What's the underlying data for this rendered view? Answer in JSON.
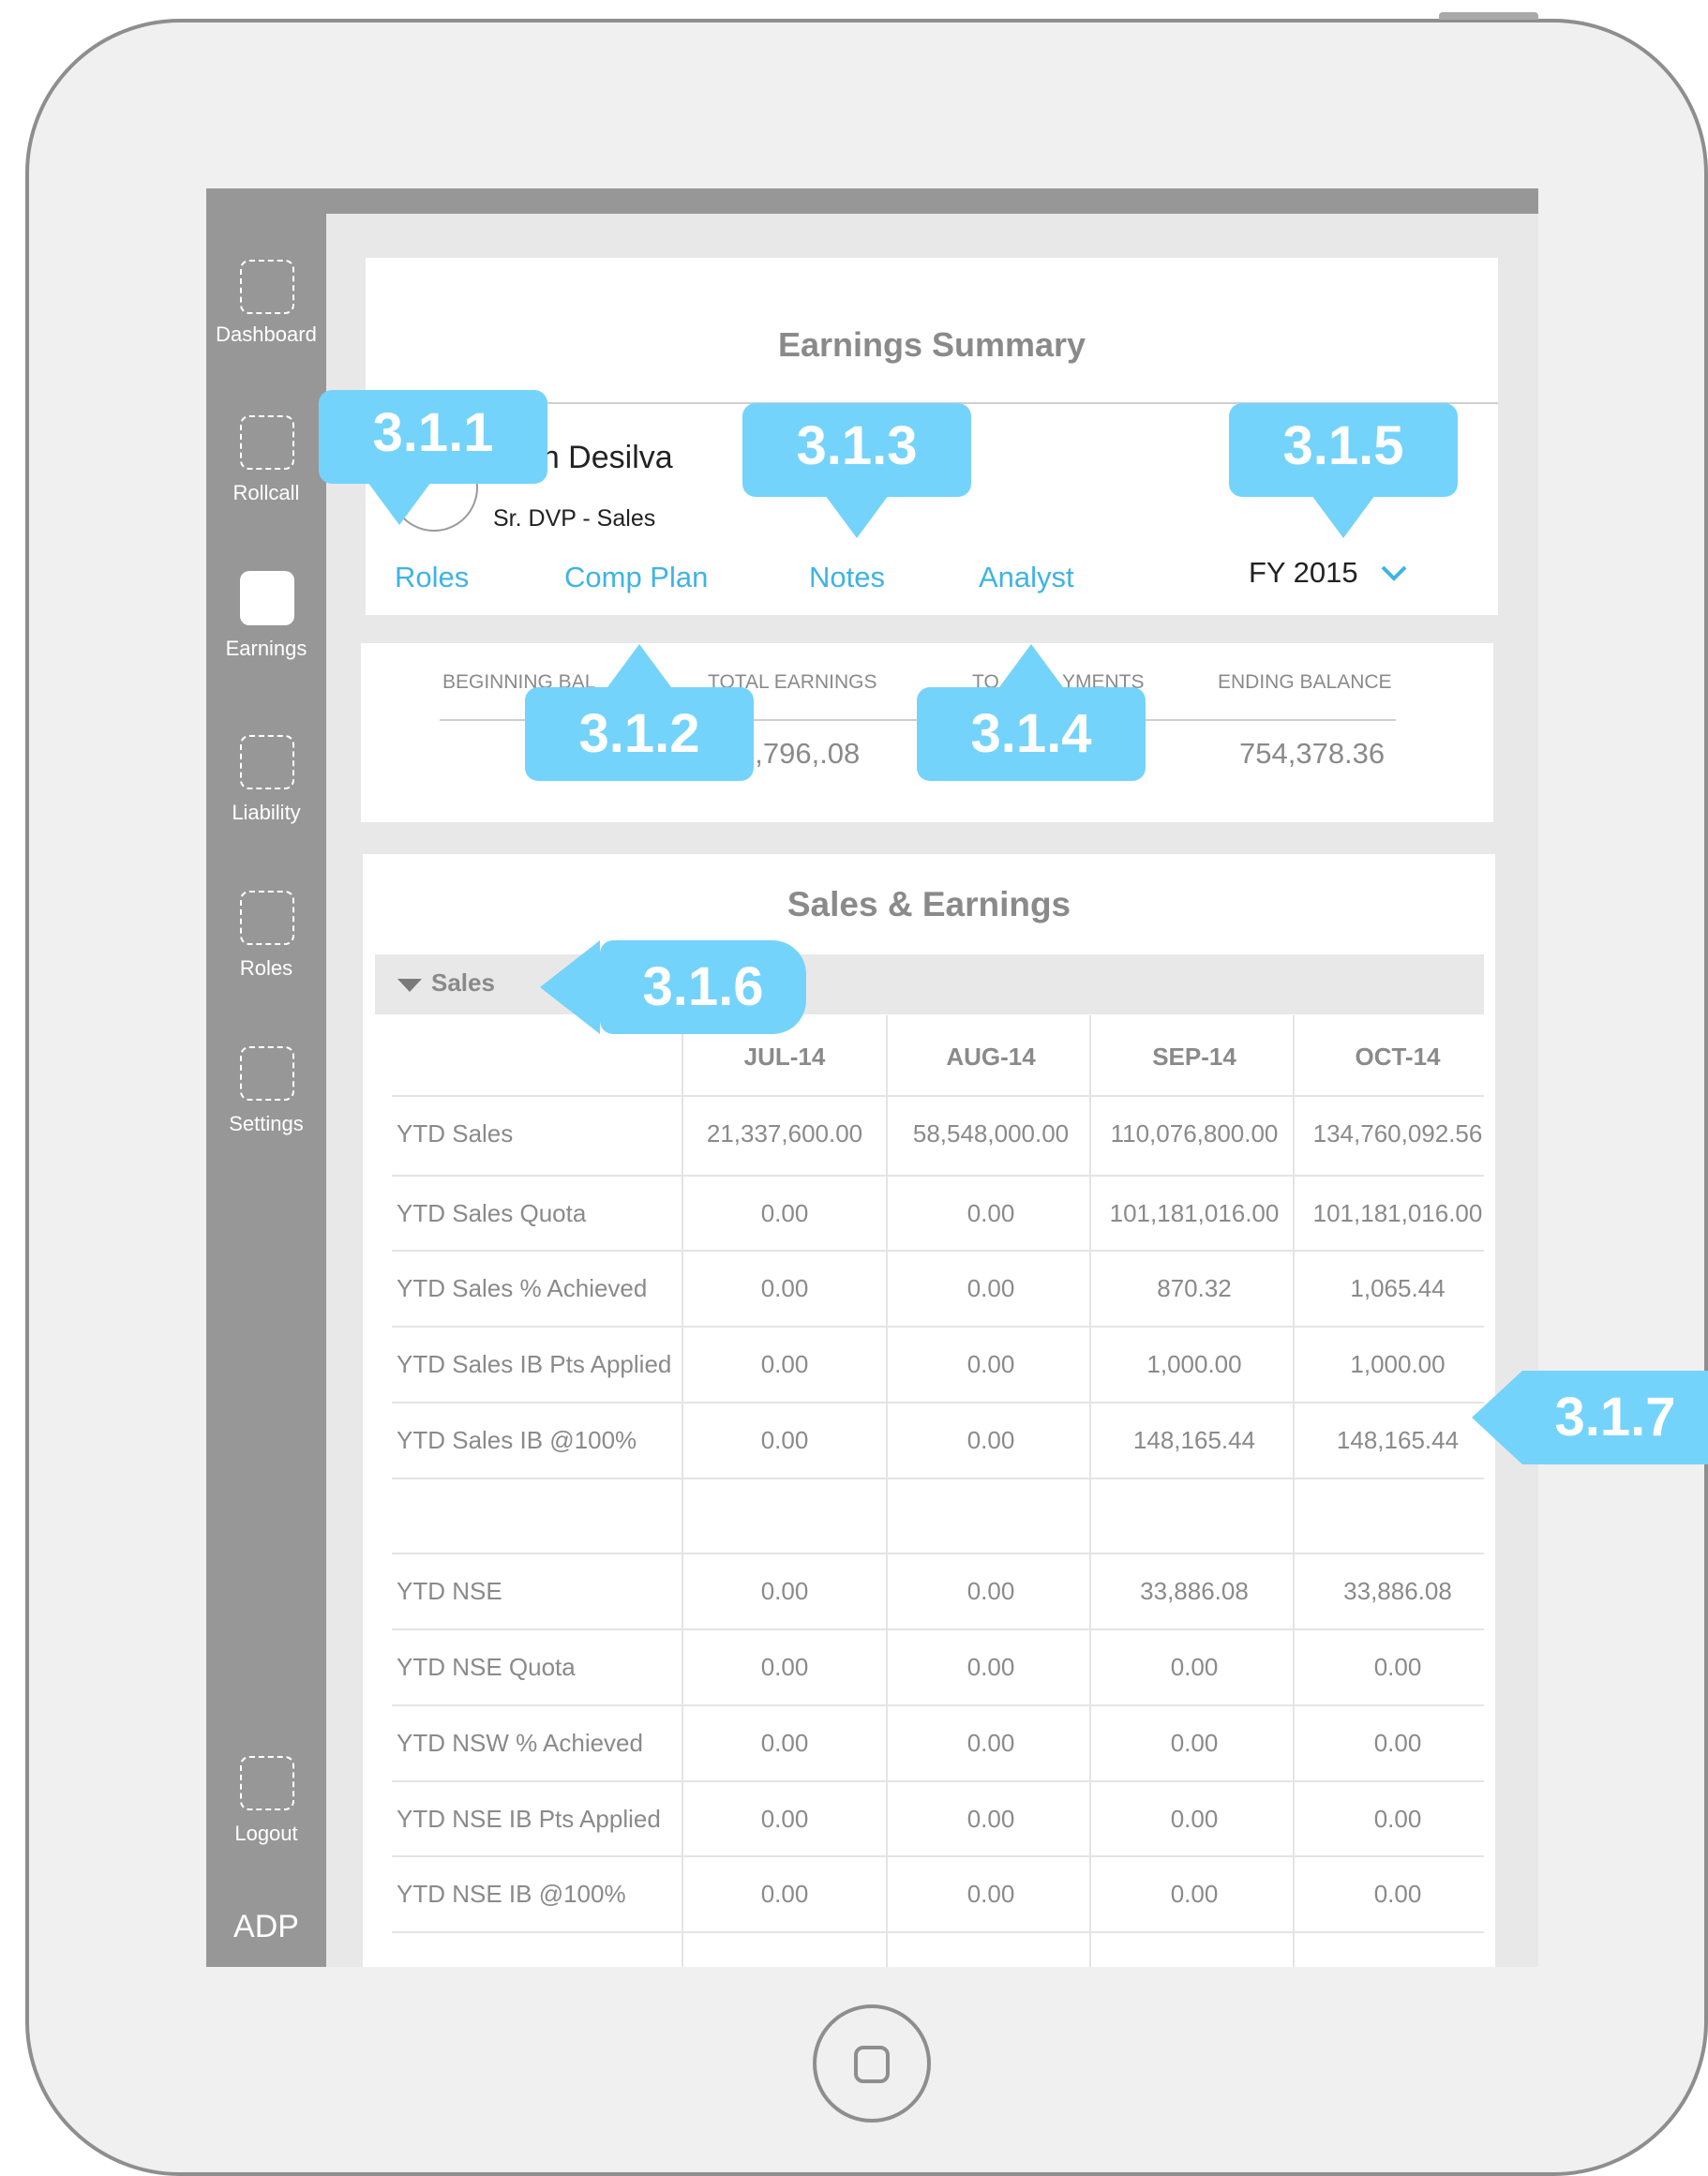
{
  "sidebar": {
    "items": [
      {
        "label": "Dashboard",
        "icon": "dashboard-icon"
      },
      {
        "label": "Rollcall",
        "icon": "rollcall-icon"
      },
      {
        "label": "Earnings",
        "icon": "earnings-icon",
        "active": true
      },
      {
        "label": "Liability",
        "icon": "liability-icon"
      },
      {
        "label": "Roles",
        "icon": "roles-icon"
      },
      {
        "label": "Settings",
        "icon": "settings-icon"
      }
    ],
    "logout": {
      "label": "Logout",
      "icon": "logout-icon"
    },
    "brand": "ADP"
  },
  "header": {
    "title": "Earnings Summary",
    "share_icon": "share-icon",
    "person_name": "Joseph Desilva",
    "person_name_visible": "eph Desilva",
    "person_role": "Sr. DVP  - Sales",
    "links": {
      "roles": "Roles",
      "comp_plan": "Comp Plan",
      "notes": "Notes",
      "analyst": "Analyst"
    },
    "fiscal_year": "FY 2015",
    "accent_color": "#3fb3e6"
  },
  "balances": {
    "labels": {
      "beginning": "BEGINNING BAL",
      "total_earnings": "TOTAL EARNINGS",
      "total_payments": "TO",
      "total_payments_tail": "YMENTS",
      "ending": "ENDING BALANCE"
    },
    "values": {
      "total_earnings": "6,796,.08",
      "ending": "754,378.36"
    }
  },
  "sales_earnings": {
    "title": "Sales & Earnings",
    "section": "Sales",
    "columns": [
      "JUL-14",
      "AUG-14",
      "SEP-14",
      "OCT-14"
    ],
    "rows": [
      {
        "label": "YTD Sales",
        "values": [
          "21,337,600.00",
          "58,548,000.00",
          "110,076,800.00",
          "134,760,092.56"
        ]
      },
      {
        "label": "YTD Sales Quota",
        "values": [
          "0.00",
          "0.00",
          "101,181,016.00",
          "101,181,016.00"
        ]
      },
      {
        "label": "YTD Sales % Achieved",
        "values": [
          "0.00",
          "0.00",
          "870.32",
          "1,065.44"
        ]
      },
      {
        "label": "YTD Sales IB Pts Applied",
        "values": [
          "0.00",
          "0.00",
          "1,000.00",
          "1,000.00"
        ]
      },
      {
        "label": "YTD Sales IB @100%",
        "values": [
          "0.00",
          "0.00",
          "148,165.44",
          "148,165.44"
        ]
      },
      {
        "label": "",
        "values": [
          "",
          "",
          "",
          ""
        ]
      },
      {
        "label": "YTD NSE",
        "values": [
          "0.00",
          "0.00",
          "33,886.08",
          "33,886.08"
        ]
      },
      {
        "label": "YTD NSE Quota",
        "values": [
          "0.00",
          "0.00",
          "0.00",
          "0.00"
        ]
      },
      {
        "label": "YTD NSW % Achieved",
        "values": [
          "0.00",
          "0.00",
          "0.00",
          "0.00"
        ]
      },
      {
        "label": "YTD NSE IB Pts Applied",
        "values": [
          "0.00",
          "0.00",
          "0.00",
          "0.00"
        ]
      },
      {
        "label": "YTD NSE IB @100%",
        "values": [
          "0.00",
          "0.00",
          "0.00",
          "0.00"
        ]
      }
    ]
  },
  "callouts": {
    "c311": "3.1.1",
    "c312": "3.1.2",
    "c313": "3.1.3",
    "c314": "3.1.4",
    "c315": "3.1.5",
    "c316": "3.1.6",
    "c317": "3.1.7",
    "color": "#74d3fb"
  }
}
